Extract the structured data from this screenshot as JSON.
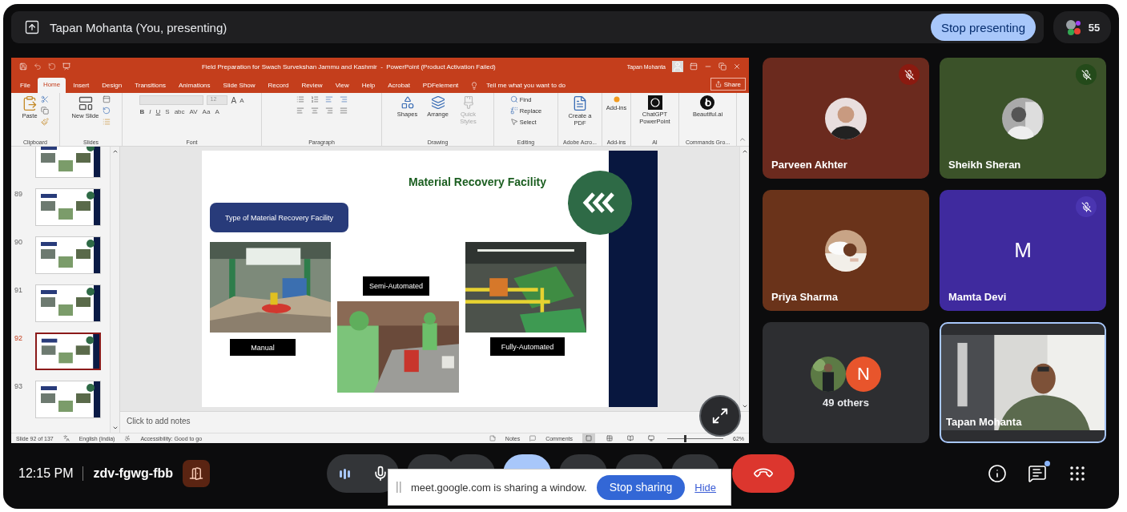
{
  "top_bar": {
    "presenter": "Tapan Mohanta (You, presenting)",
    "stop_button": "Stop presenting",
    "participant_count": "55"
  },
  "powerpoint": {
    "title": "Field Preparation for Swach Survekshan Jammu and Kashmir  -  PowerPoint (Product Activation Failed)",
    "user": "Tapan Mohanta",
    "tabs": [
      {
        "label": "File",
        "selected": false
      },
      {
        "label": "Home",
        "selected": true
      },
      {
        "label": "Insert",
        "selected": false
      },
      {
        "label": "Design",
        "selected": false
      },
      {
        "label": "Transitions",
        "selected": false
      },
      {
        "label": "Animations",
        "selected": false
      },
      {
        "label": "Slide Show",
        "selected": false
      },
      {
        "label": "Record",
        "selected": false
      },
      {
        "label": "Review",
        "selected": false
      },
      {
        "label": "View",
        "selected": false
      },
      {
        "label": "Help",
        "selected": false
      },
      {
        "label": "Acrobat",
        "selected": false
      },
      {
        "label": "PDFelement",
        "selected": false
      }
    ],
    "tell_me": "Tell me what you want to do",
    "share": "Share",
    "ribbon_groups": [
      {
        "kind": "clipboard",
        "label": "Clipboard",
        "button": "Paste"
      },
      {
        "kind": "slides",
        "label": "Slides",
        "button": "New Slide"
      },
      {
        "kind": "font",
        "label": "Font",
        "size": "12",
        "size_buttons": [
          "A",
          "A"
        ],
        "styles": [
          "B",
          "I",
          "U",
          "S",
          "abc",
          "AV",
          "Aa",
          "A"
        ]
      },
      {
        "kind": "paragraph",
        "label": "Paragraph"
      },
      {
        "kind": "drawing",
        "label": "Drawing",
        "buttons": [
          {
            "label": "Shapes",
            "disabled": false
          },
          {
            "label": "Arrange",
            "disabled": false
          },
          {
            "label": "Quick Styles",
            "disabled": true
          }
        ]
      },
      {
        "kind": "editing",
        "label": "Editing",
        "buttons": [
          "Find",
          "Replace",
          "Select"
        ]
      },
      {
        "kind": "pdf",
        "label": "Adobe Acro...",
        "button": "Create a PDF"
      },
      {
        "kind": "addins",
        "label": "Add-ins",
        "button": "Add-ins"
      },
      {
        "kind": "chatgpt",
        "label": "AI",
        "button": "ChatGPT PowerPoint"
      },
      {
        "kind": "beautiful",
        "label": "Commands Gro...",
        "button": "Beautiful.ai"
      }
    ],
    "thumbnails": [
      {
        "selected": false
      },
      {
        "number": "89",
        "selected": false
      },
      {
        "number": "90",
        "selected": false
      },
      {
        "number": "91",
        "selected": false
      },
      {
        "number": "92",
        "selected": true
      },
      {
        "number": "93",
        "selected": false
      }
    ],
    "slide": {
      "title": "Material Recovery Facility",
      "label": "Type of Material Recovery Facility",
      "captions": [
        "Manual",
        "Semi-Automated",
        "Fully-Automated"
      ]
    },
    "notes_placeholder": "Click to add notes",
    "status_bar": {
      "slide": "Slide 92 of 137",
      "language": "English (India)",
      "accessibility": "Accessibility: Good to go",
      "notes": "Notes",
      "comments": "Comments",
      "views": [
        {
          "selected": true
        },
        {
          "selected": false
        },
        {
          "selected": false
        },
        {
          "selected": false
        }
      ],
      "zoom": {
        "reading": "62%",
        "level": 0.3
      }
    }
  },
  "tiles": [
    {
      "kind": "avatar",
      "name": "Parveen Akhter",
      "muted": true,
      "color": "#6b2a1e"
    },
    {
      "kind": "avatar",
      "name": "Sheikh Sheran",
      "muted": true,
      "color": "#3b5229"
    },
    {
      "kind": "avatar",
      "name": "Priya Sharma",
      "muted": false,
      "color": "#6a331a"
    },
    {
      "kind": "initial",
      "name": "Mamta Devi",
      "initial": "M",
      "muted": true,
      "color": "#3f2a9e"
    },
    {
      "kind": "others",
      "initial": "N",
      "label": "49 others"
    },
    {
      "kind": "video",
      "name": "Tapan Mohanta"
    }
  ],
  "bottom_bar": {
    "time": "12:15 PM",
    "meeting_code": "zdv-fgwg-fbb",
    "chat_unread": true,
    "share_banner": {
      "message": "meet.google.com is sharing a window.",
      "stop": "Stop sharing",
      "hide": "Hide"
    }
  }
}
